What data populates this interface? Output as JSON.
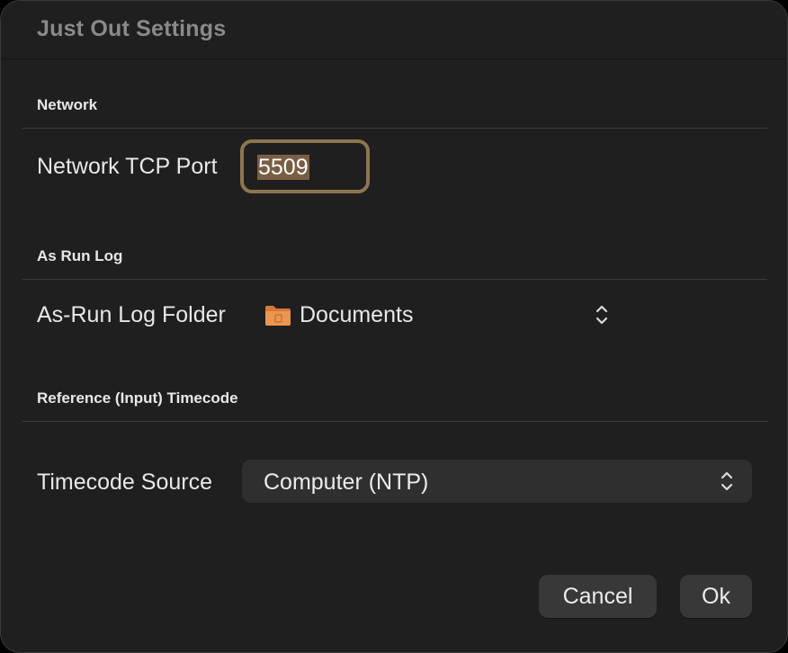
{
  "window": {
    "title": "Just Out Settings"
  },
  "sections": {
    "network": {
      "header": "Network",
      "port_label": "Network TCP Port",
      "port_value": "5509"
    },
    "as_run_log": {
      "header": "As Run Log",
      "folder_label": "As-Run Log Folder",
      "folder_value": "Documents",
      "folder_icon": "folder-icon"
    },
    "timecode": {
      "header": "Reference (Input) Timecode",
      "source_label": "Timecode Source",
      "source_value": "Computer (NTP)"
    }
  },
  "buttons": {
    "cancel": "Cancel",
    "ok": "Ok"
  },
  "colors": {
    "background": "#1f1f1f",
    "focus_ring": "#8e7550",
    "selection": "#7a5e44",
    "folder": "#e8904a",
    "button": "#383838"
  }
}
